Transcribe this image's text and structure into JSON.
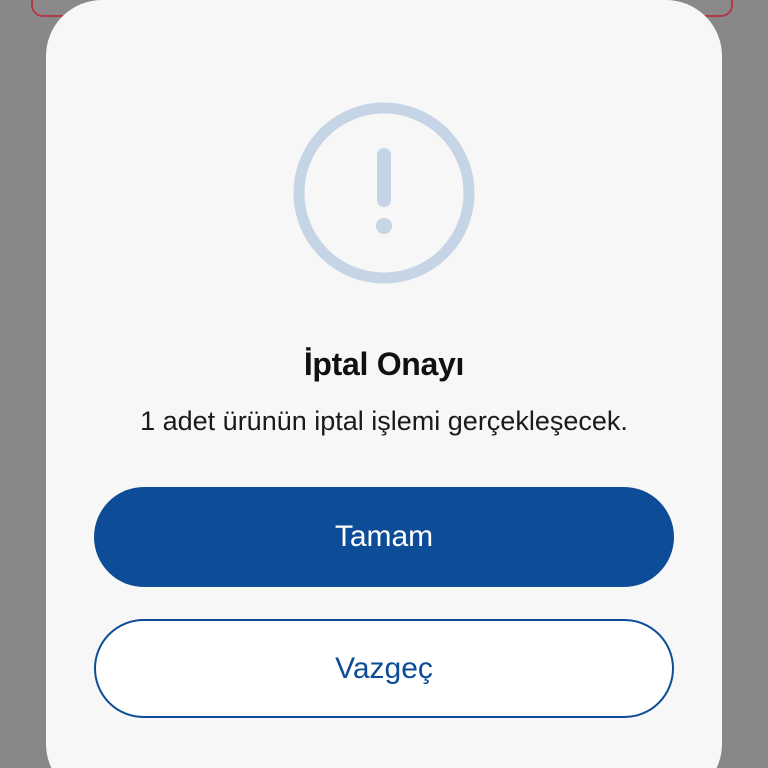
{
  "dialog": {
    "icon": "alert-circle-icon",
    "title": "İptal Onayı",
    "message": "1 adet ürünün iptal işlemi gerçekleşecek.",
    "confirm_label": "Tamam",
    "cancel_label": "Vazgeç"
  },
  "colors": {
    "overlay": "#888888",
    "dialog_background": "#f7f7f7",
    "primary": "#0d4c96",
    "icon": "#c5d5e6"
  }
}
